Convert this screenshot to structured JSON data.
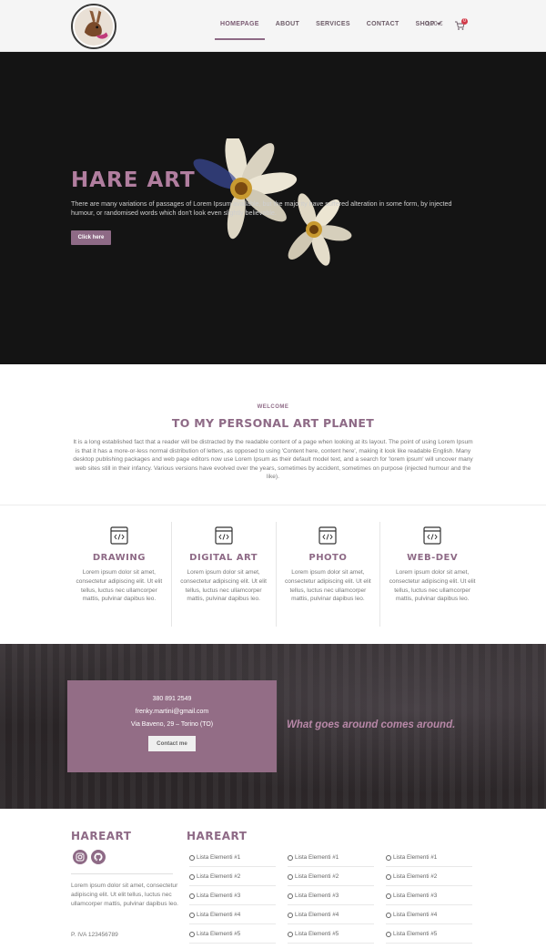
{
  "header": {
    "nav": [
      {
        "label": "HOMEPAGE",
        "active": true
      },
      {
        "label": "ABOUT"
      },
      {
        "label": "SERVICES"
      },
      {
        "label": "CONTACT"
      },
      {
        "label": "SHOP",
        "has_dropdown": true
      }
    ],
    "cart_total": "0,00 €",
    "cart_count": "0"
  },
  "hero": {
    "title": "HARE ART",
    "text": "There are many variations of passages of Lorem Ipsum available, but the majority have suffered alteration in some form, by injected humour, or randomised words which don't look even slightly believable.",
    "button_label": "Click here"
  },
  "welcome": {
    "kicker": "WELCOME",
    "title": "TO MY PERSONAL ART PLANET",
    "text": "It is a long established fact that a reader will be distracted by the readable content of a page when looking at its layout. The point of using Lorem Ipsum is that it has a more-or-less normal distribution of letters, as opposed to using 'Content here, content here', making it look like readable English. Many desktop publishing packages and web page editors now use Lorem Ipsum as their default model text, and a search for 'lorem ipsum' will uncover many web sites still in their infancy. Various versions have evolved over the years, sometimes by accident, sometimes on purpose (injected humour and the like)."
  },
  "services": [
    {
      "title": "DRAWING",
      "icon": "code-window-icon",
      "text": "Lorem ipsum dolor sit amet, consectetur adipiscing elit. Ut elit tellus, luctus nec ullamcorper mattis, pulvinar dapibus leo."
    },
    {
      "title": "DIGITAL ART",
      "icon": "code-window-icon",
      "text": "Lorem ipsum dolor sit amet, consectetur adipiscing elit. Ut elit tellus, luctus nec ullamcorper mattis, pulvinar dapibus leo."
    },
    {
      "title": "PHOTO",
      "icon": "code-window-icon",
      "text": "Lorem ipsum dolor sit amet, consectetur adipiscing elit. Ut elit tellus, luctus nec ullamcorper mattis, pulvinar dapibus leo."
    },
    {
      "title": "WEB-DEV",
      "icon": "code-window-icon",
      "text": "Lorem ipsum dolor sit amet, consectetur adipiscing elit. Ut elit tellus, luctus nec ullamcorper mattis, pulvinar dapibus leo."
    }
  ],
  "contact": {
    "phone": "380 891 2549",
    "email": "frenky.martini@gmail.com",
    "address": "Via Baveno, 29 – Torino (TO)",
    "button_label": "Contact me",
    "tagline": "What goes around comes around."
  },
  "footer": {
    "brand": "HAREART",
    "social_icons": [
      "instagram-icon",
      "github-icon"
    ],
    "text": "Lorem ipsum dolor sit amet, consectetur adipiscing elit. Ut elit tellus, luctus nec ullamcorper mattis, pulvinar dapibus leo.",
    "vat": "P. IVA 123456789",
    "list_title": "HAREART",
    "lists": [
      [
        "Lista Elementi #1",
        "Lista Elementi #2",
        "Lista Elementi #3",
        "Lista Elementi #4",
        "Lista Elementi #5"
      ],
      [
        "Lista Elementi #1",
        "Lista Elementi #2",
        "Lista Elementi #3",
        "Lista Elementi #4",
        "Lista Elementi #5"
      ],
      [
        "Lista Elementi #1",
        "Lista Elementi #2",
        "Lista Elementi #3",
        "Lista Elementi #4",
        "Lista Elementi #5"
      ]
    ]
  },
  "colors": {
    "accent": "#8e6a86",
    "hero_bg": "#141414",
    "contact_box": "#936d86",
    "tagline": "#b888a8"
  }
}
